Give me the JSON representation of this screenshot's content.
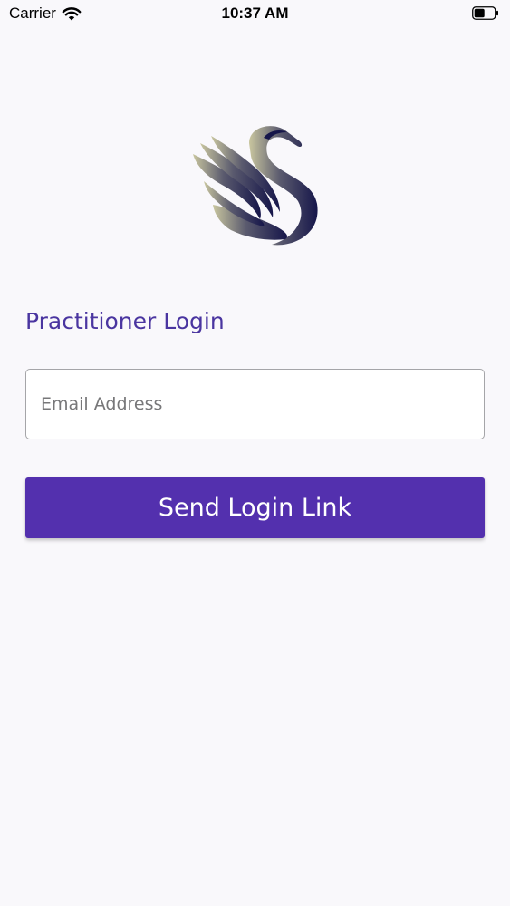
{
  "status_bar": {
    "carrier": "Carrier",
    "time": "10:37 AM",
    "wifi_icon": "wifi-icon",
    "battery_icon": "battery-icon"
  },
  "logo": {
    "icon": "swan-logo-icon"
  },
  "login": {
    "title": "Practitioner Login",
    "email_placeholder": "Email Address",
    "email_value": "",
    "send_button_label": "Send Login Link"
  },
  "colors": {
    "accent": "#5330ae",
    "title": "#4a35a0",
    "background": "#f9f8fb"
  }
}
